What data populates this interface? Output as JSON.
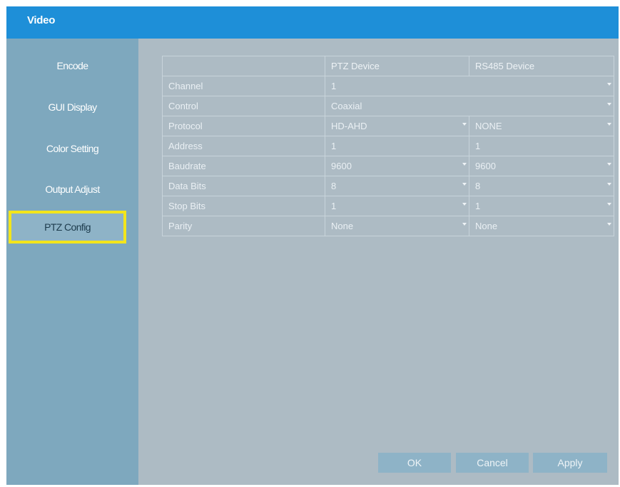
{
  "window": {
    "title": "Video"
  },
  "sidebar": {
    "items": [
      {
        "label": "Encode"
      },
      {
        "label": "GUI Display"
      },
      {
        "label": "Color Setting"
      },
      {
        "label": "Output Adjust"
      },
      {
        "label": "PTZ Config"
      }
    ],
    "active": "PTZ Config"
  },
  "ptz_table": {
    "headers": [
      "",
      "PTZ Device",
      "RS485 Device"
    ],
    "rows": {
      "channel": {
        "label": "Channel",
        "value": "1"
      },
      "control": {
        "label": "Control",
        "value": "Coaxial"
      },
      "protocol": {
        "label": "Protocol",
        "ptz": "HD-AHD",
        "rs485": "NONE"
      },
      "address": {
        "label": "Address",
        "ptz": "1",
        "rs485": "1"
      },
      "baudrate": {
        "label": "Baudrate",
        "ptz": "9600",
        "rs485": "9600"
      },
      "data_bits": {
        "label": "Data Bits",
        "ptz": "8",
        "rs485": "8"
      },
      "stop_bits": {
        "label": "Stop Bits",
        "ptz": "1",
        "rs485": "1"
      },
      "parity": {
        "label": "Parity",
        "ptz": "None",
        "rs485": "None"
      }
    }
  },
  "buttons": {
    "ok": "OK",
    "cancel": "Cancel",
    "apply": "Apply"
  },
  "colors": {
    "title_bar": "#1e8fd8",
    "sidebar": "#7ea8be",
    "content": "#adbbc4",
    "highlight": "#f3e51c",
    "button": "#8eb3c7"
  },
  "icons": [
    "dropdown-arrow-icon"
  ]
}
